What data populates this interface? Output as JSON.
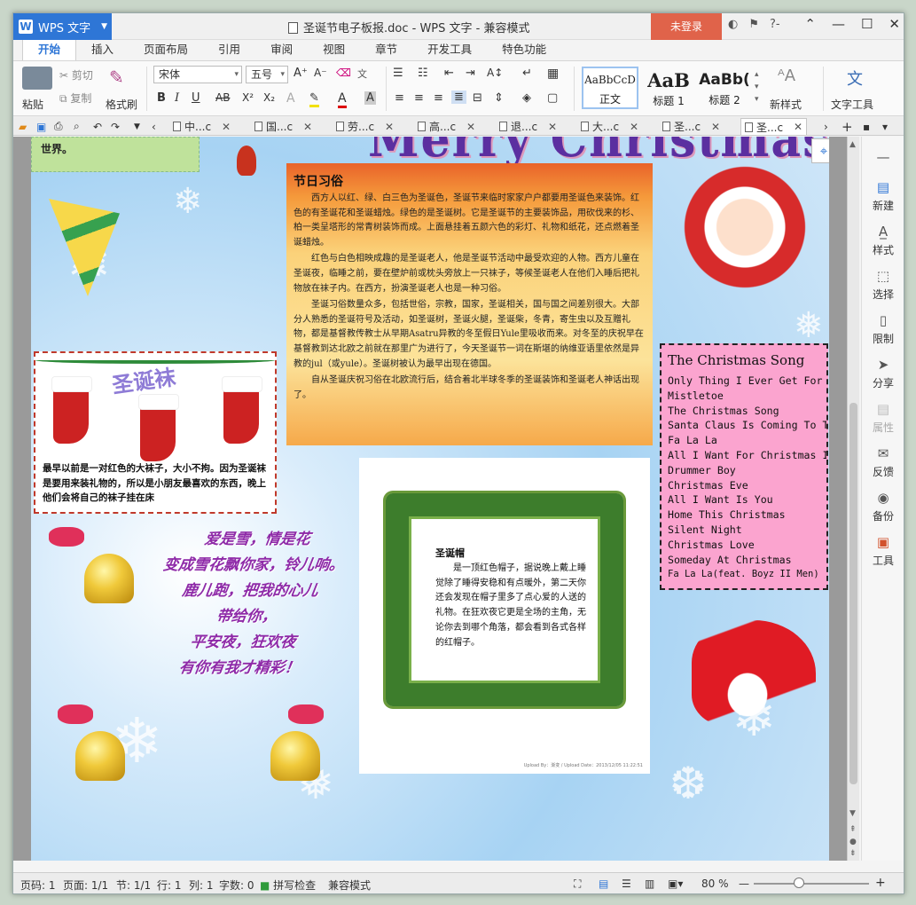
{
  "app": {
    "name": "WPS 文字",
    "doc_title": "圣诞节电子板报.doc - WPS 文字 - 兼容模式",
    "login": "未登录"
  },
  "menu": {
    "tabs": [
      "开始",
      "插入",
      "页面布局",
      "引用",
      "审阅",
      "视图",
      "章节",
      "开发工具",
      "特色功能"
    ]
  },
  "ribbon": {
    "paste": "粘贴",
    "cut": "剪切",
    "copy": "复制",
    "format_painter": "格式刷",
    "font_name": "宋体",
    "font_size": "五号",
    "styles": [
      {
        "preview": "AaBbCcD",
        "name": "正文"
      },
      {
        "preview": "AaB",
        "name": "标题 1"
      },
      {
        "preview": "AaBb(",
        "name": "标题 2"
      }
    ],
    "new_style": "新样式",
    "text_tools": "文字工具"
  },
  "doc_tabs": [
    "中...c",
    "国...c",
    "劳...c",
    "高...c",
    "退...c",
    "大...c",
    "圣...c",
    "圣...c"
  ],
  "document": {
    "top_fragment": "世界。",
    "header_art": "Merry Christmas",
    "customs": {
      "title": "节日习俗",
      "paragraphs": [
        "西方人以红、绿、白三色为圣诞色，圣诞节来临时家家户户都要用圣诞色来装饰。红色的有圣诞花和圣诞蜡烛。绿色的是圣诞树。它是圣诞节的主要装饰品，用砍伐来的杉、柏一类呈塔形的常青树装饰而成。上面悬挂着五颜六色的彩灯、礼物和纸花，还点燃着圣诞蜡烛。",
        "红色与白色相映成趣的是圣诞老人，他是圣诞节活动中最受欢迎的人物。西方儿童在圣诞夜，临睡之前，要在壁炉前或枕头旁放上一只袜子，等候圣诞老人在他们入睡后把礼物放在袜子内。在西方，扮演圣诞老人也是一种习俗。",
        "圣诞习俗数量众多，包括世俗，宗教，国家，圣诞相关，国与国之间差别很大。大部分人熟悉的圣诞符号及活动，如圣诞树，圣诞火腿，圣诞柴，冬青，寄生虫以及互赠礼物，都是基督教传教士从早期Asatru异教的冬至假日Yule里吸收而来。对冬至的庆祝早在基督教到达北欧之前就在那里广为进行了，今天圣诞节一词在斯堪的纳维亚语里依然是异教的jul（或yule）。圣诞树被认为最早出现在德国。",
        "自从圣诞庆祝习俗在北欧流行后，结合着北半球冬季的圣诞装饰和圣诞老人神话出现了。"
      ]
    },
    "socks": {
      "title": "圣诞袜",
      "text": "最早以前是一对红色的大袜子，大小不拘。因为圣诞袜是要用来装礼物的，所以是小朋友最喜欢的东西，晚上他们会将自己的袜子挂在床"
    },
    "poem": [
      "爱是雪，情是花",
      "变成雪花飘你家，铃儿响。",
      "鹿儿跑，把我的心儿",
      "带给你，",
      "平安夜，狂欢夜",
      "有你有我才精彩！"
    ],
    "hat": {
      "title": "圣诞帽",
      "text": "是一顶红色帽子，据说晚上戴上睡觉除了睡得安稳和有点暖外，第二天你还会发现在帽子里多了点心爱的人送的礼物。在狂欢夜它更是全场的主角，无论你去到哪个角落，都会看到各式各样的红帽子。",
      "credit": "Upload By：渐变 / Upload Date：2013/12/05 11:22:51"
    },
    "songs": {
      "title": "The Christmas Song",
      "items": [
        "Only Thing I Ever Get For Christ",
        "Mistletoe",
        "The Christmas Song",
        "Santa Claus Is Coming To Town",
        "Fa La La",
        "All I Want For Christmas Is You",
        "Drummer Boy",
        "Christmas Eve",
        "All I Want Is You",
        "Home This Christmas",
        "Silent Night",
        "Christmas Love",
        "Someday At Christmas",
        "Fa La La(feat. Boyz II Men)"
      ]
    }
  },
  "taskpane": [
    "新建",
    "样式",
    "选择",
    "限制",
    "分享",
    "属性",
    "反馈",
    "备份",
    "工具"
  ],
  "status": {
    "page_no": "页码: 1",
    "pages": "页面: 1/1",
    "section": "节: 1/1",
    "row": "行: 1",
    "col": "列: 1",
    "words": "字数: 0",
    "spell": "拼写检查",
    "mode": "兼容模式",
    "zoom": "80 %"
  },
  "colors": {
    "accent": "#2e76d6",
    "login_bg": "#e0634a",
    "songs_bg": "#fba4cf",
    "poem": "#8e2aa8"
  }
}
